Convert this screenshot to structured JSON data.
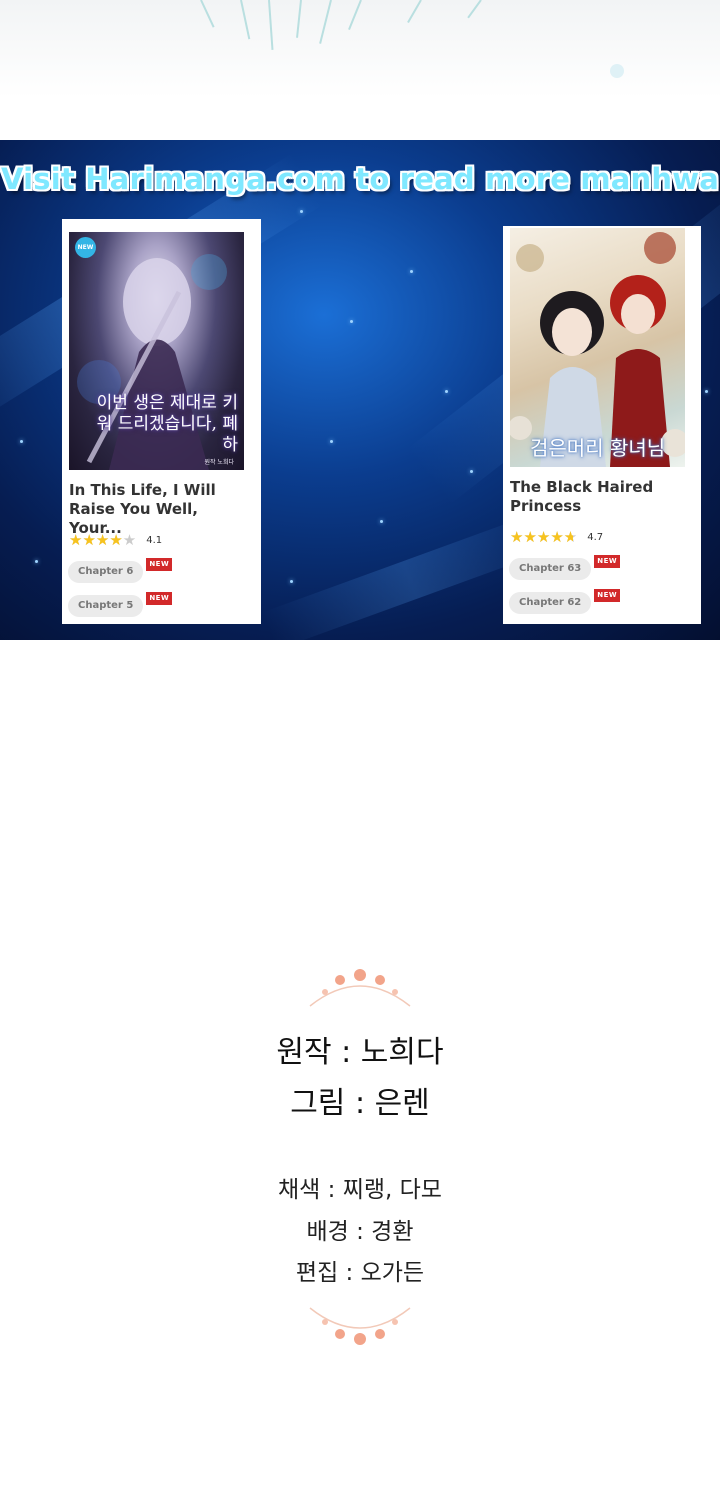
{
  "banner": {
    "title": "Visit Harimanga.com to read more manhwa"
  },
  "cards": [
    {
      "badge": "NEW",
      "cover_text": "이번 생은 제대로 키워 드리겠습니다, 폐하",
      "cover_subtext": "원작 노희다",
      "title": "In This Life, I Will Raise You Well, Your...",
      "rating": 4.1,
      "rating_label": "4.1",
      "chapters": [
        {
          "label": "Chapter 6",
          "tag": "NEW"
        },
        {
          "label": "Chapter 5",
          "tag": "NEW"
        }
      ]
    },
    {
      "cover_text": "검은머리 황녀님",
      "title": "The Black Haired Princess",
      "rating": 4.7,
      "rating_label": "4.7",
      "chapters": [
        {
          "label": "Chapter 63",
          "tag": "NEW"
        },
        {
          "label": "Chapter 62",
          "tag": "NEW"
        }
      ]
    }
  ],
  "credits": {
    "original": "원작 : 노희다",
    "art": "그림 : 은렌",
    "coloring": "채색 : 찌랭, 다모",
    "background": "배경 : 경환",
    "editing": "편집 : 오가든"
  },
  "colors": {
    "banner_title": "#7fe8ff",
    "star": "#f7c31e",
    "new_tag": "#d2292a",
    "ornament": "#f2a48a"
  }
}
